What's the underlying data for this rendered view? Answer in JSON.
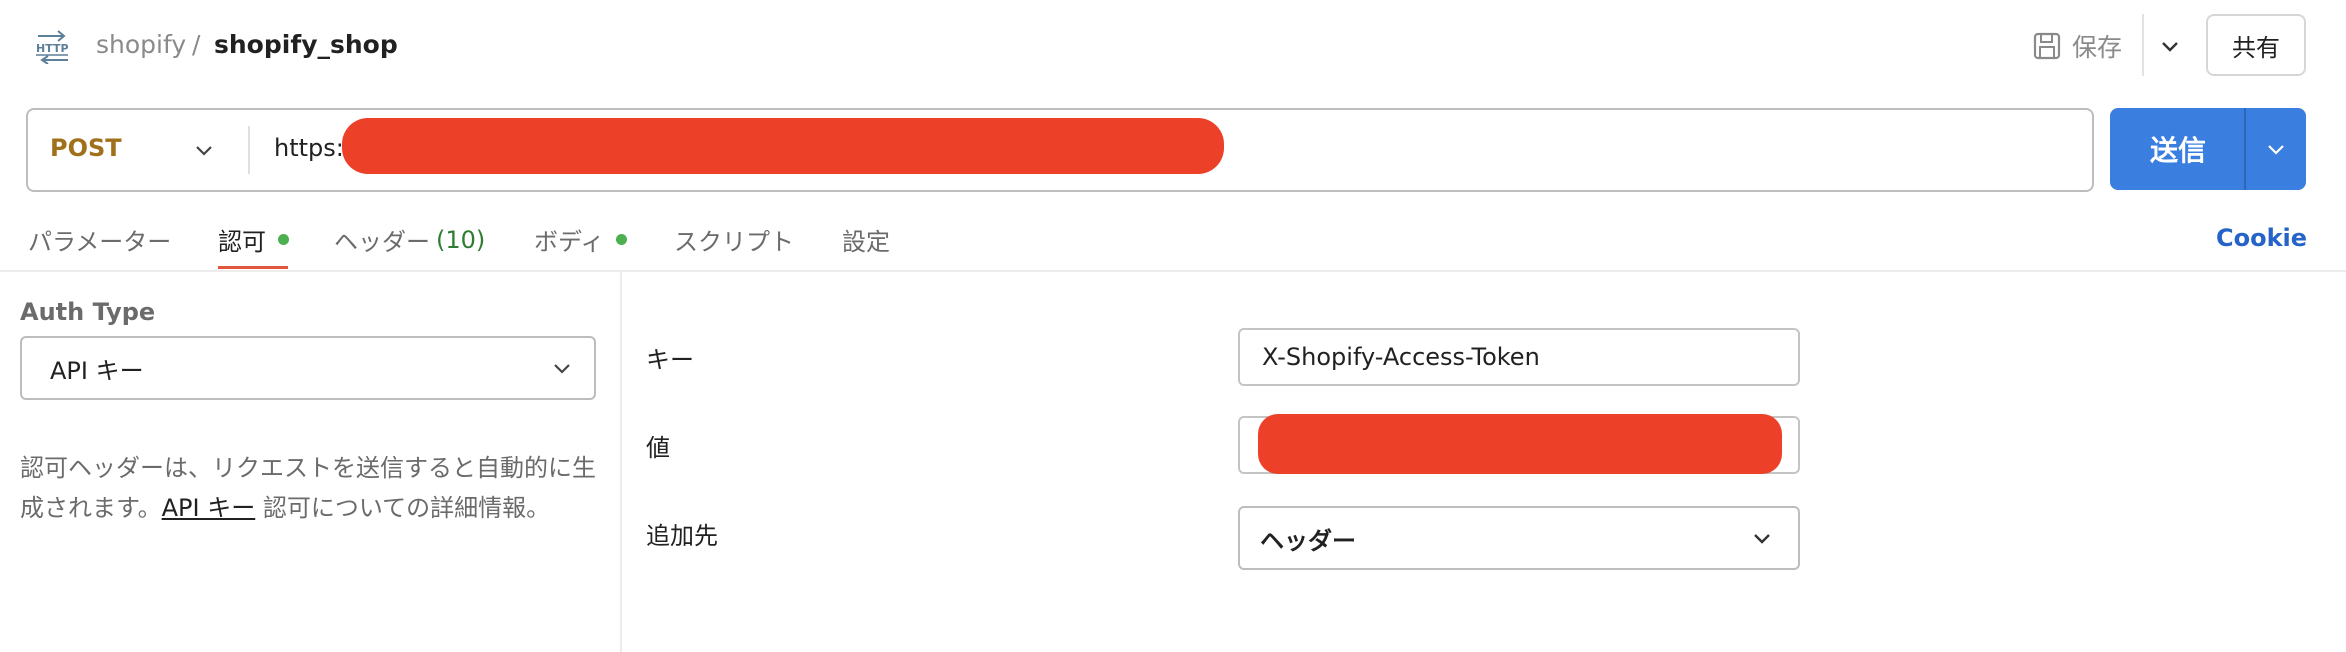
{
  "header": {
    "protocol_icon": "http-icon",
    "breadcrumb_parent": "shopify",
    "breadcrumb_separator": "/",
    "breadcrumb_current": "shopify_shop",
    "save_label": "保存",
    "share_label": "共有"
  },
  "request": {
    "method": "POST",
    "url_prefix": "https:",
    "send_label": "送信"
  },
  "tabs": [
    {
      "label": "パラメーター",
      "dot": false
    },
    {
      "label": "認可",
      "dot": true,
      "active": true
    },
    {
      "label": "ヘッダー",
      "count": "(10)"
    },
    {
      "label": "ボディ",
      "dot": true
    },
    {
      "label": "スクリプト"
    },
    {
      "label": "設定"
    }
  ],
  "cookie_label": "Cookie",
  "auth": {
    "type_label": "Auth Type",
    "type_value": "API キー",
    "description_pre": "認可ヘッダーは、リクエストを送信すると自動的に生成されます。",
    "description_link": "API キー",
    "description_post": " 認可についての詳細情報。"
  },
  "form": {
    "key_label": "キー",
    "key_value": "X-Shopify-Access-Token",
    "value_label": "値",
    "addto_label": "追加先",
    "addto_value": "ヘッダー"
  },
  "colors": {
    "accent_blue": "#3a7ee0",
    "method_color": "#a0701a",
    "redaction": "#ec4029",
    "active_tab_underline": "#e0573e",
    "dot_green": "#4caf50"
  }
}
